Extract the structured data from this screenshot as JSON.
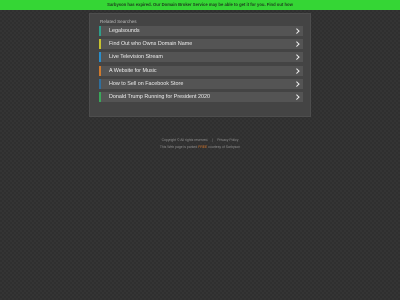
{
  "banner": {
    "text": "Sarbyson has expired. Our Domain Broker Service may be able to get it for you. Find out how",
    "color": "#35d635"
  },
  "panel": {
    "heading": "Related Searches",
    "items": [
      {
        "label": "Legalsounds",
        "accent": "#2e9e8c",
        "icon": "chevron-right-icon"
      },
      {
        "label": "Find Out who Owns Domain Name",
        "accent": "#c7c230",
        "icon": "chevron-right-icon"
      },
      {
        "label": "Live Television Stream",
        "accent": "#2a8fcc",
        "icon": "chevron-right-icon"
      },
      {
        "label": "A Website for Music",
        "accent": "#d07a2c",
        "icon": "chevron-right-icon"
      },
      {
        "label": "How to Sell on Facebook Store",
        "accent": "#2f6f9e",
        "icon": "chevron-right-icon"
      },
      {
        "label": "Donald Trump Running for President 2020",
        "accent": "#3aa85a",
        "icon": "chevron-right-icon"
      }
    ]
  },
  "footer": {
    "copyright": "Copyright ©  All rights reserved.",
    "separator": "|",
    "privacy": "Privacy Policy",
    "line2_prefix": "This Web page is parked",
    "line2_link": "FREE",
    "line2_suffix": "courtesy of Sarbyson"
  }
}
